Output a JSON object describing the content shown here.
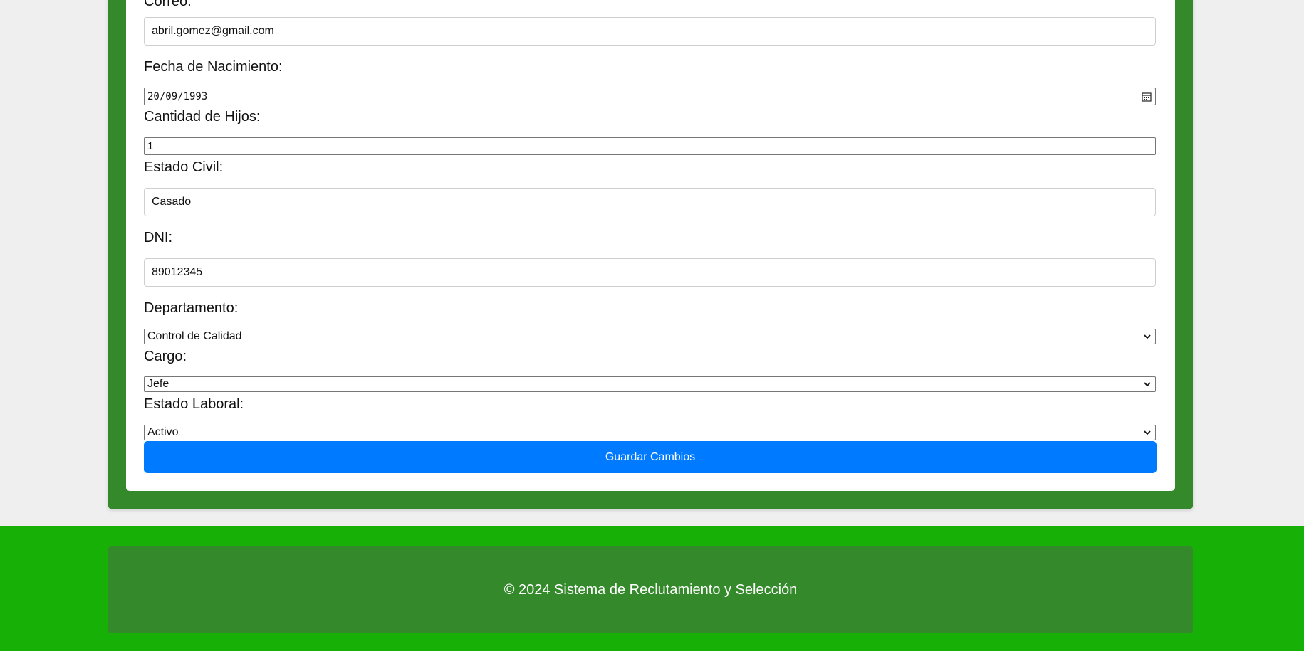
{
  "form": {
    "correo_label": "Correo:",
    "correo_value": "abril.gomez@gmail.com",
    "fecha_label": "Fecha de Nacimiento:",
    "fecha_value": "20/09/1993",
    "hijos_label": "Cantidad de Hijos:",
    "hijos_value": "1",
    "estado_civil_label": "Estado Civil:",
    "estado_civil_value": "Casado",
    "dni_label": "DNI:",
    "dni_value": "89012345",
    "departamento_label": "Departamento:",
    "departamento_value": "Control de Calidad",
    "cargo_label": "Cargo:",
    "cargo_value": "Jefe",
    "estado_laboral_label": "Estado Laboral:",
    "estado_laboral_value": "Activo",
    "save_label": "Guardar Cambios"
  },
  "footer": {
    "text": "© 2024 Sistema de Reclutamiento y Selección"
  },
  "colors": {
    "frame_green": "#348a2b",
    "footer_green": "#17b006",
    "button_blue": "#007bff"
  },
  "icons": {
    "calendar": "calendar-icon",
    "select_chevron": "chevron-down-icon"
  }
}
